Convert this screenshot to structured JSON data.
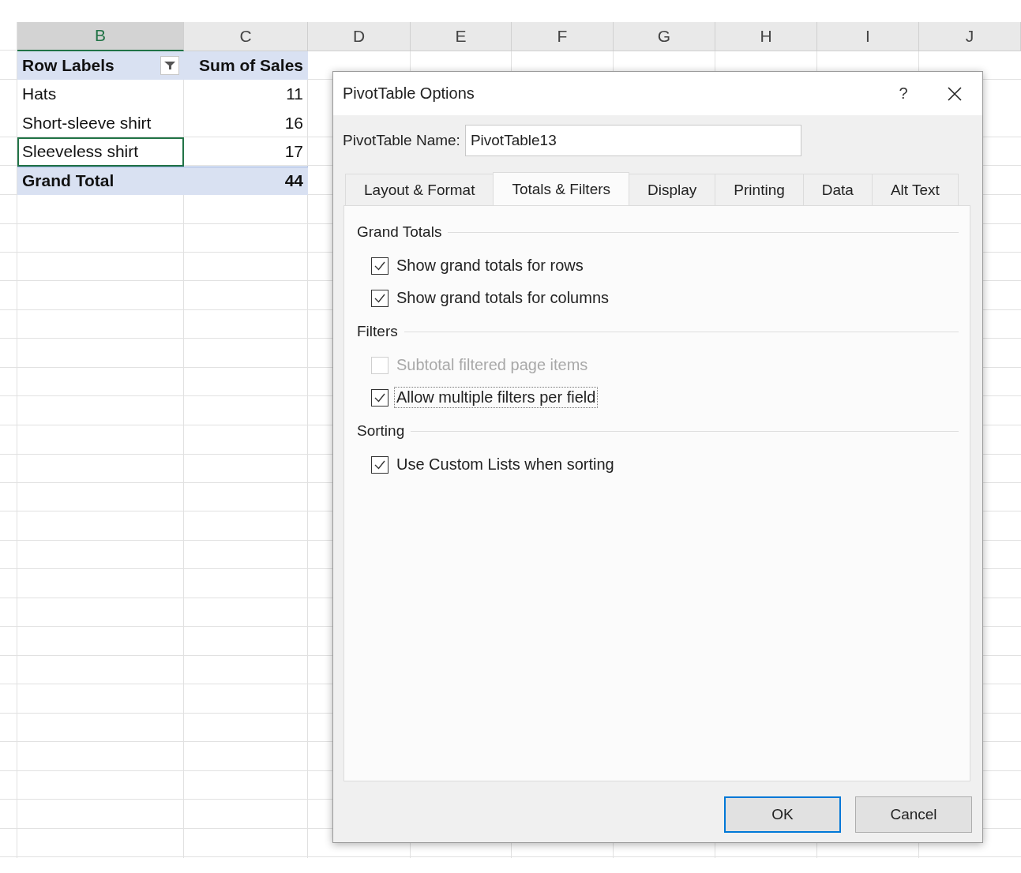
{
  "sheet": {
    "columns": [
      {
        "label": "B",
        "selected": true
      },
      {
        "label": "C",
        "selected": false
      },
      {
        "label": "D",
        "selected": false
      },
      {
        "label": "E",
        "selected": false
      },
      {
        "label": "F",
        "selected": false
      },
      {
        "label": "G",
        "selected": false
      },
      {
        "label": "H",
        "selected": false
      },
      {
        "label": "I",
        "selected": false
      },
      {
        "label": "J",
        "selected": false
      }
    ],
    "pivot": {
      "header": {
        "row_labels": "Row Labels",
        "values": "Sum of Sales"
      },
      "rows": [
        {
          "label": "Hats",
          "value": "11",
          "selected": false
        },
        {
          "label": "Short-sleeve shirt",
          "value": "16",
          "selected": false
        },
        {
          "label": "Sleeveless shirt",
          "value": "17",
          "selected": true
        }
      ],
      "total": {
        "label": "Grand Total",
        "value": "44"
      }
    }
  },
  "dialog": {
    "title": "PivotTable Options",
    "help": "?",
    "name_label": "PivotTable Name:",
    "name_value": "PivotTable13",
    "tabs": [
      {
        "label": "Layout & Format",
        "selected": false
      },
      {
        "label": "Totals & Filters",
        "selected": true
      },
      {
        "label": "Display",
        "selected": false
      },
      {
        "label": "Printing",
        "selected": false
      },
      {
        "label": "Data",
        "selected": false
      },
      {
        "label": "Alt Text",
        "selected": false
      }
    ],
    "sections": [
      {
        "title": "Grand Totals",
        "options": [
          {
            "label": "Show grand totals for rows",
            "checked": true,
            "disabled": false,
            "focused": false
          },
          {
            "label": "Show grand totals for columns",
            "checked": true,
            "disabled": false,
            "focused": false
          }
        ]
      },
      {
        "title": "Filters",
        "options": [
          {
            "label": "Subtotal filtered page items",
            "checked": false,
            "disabled": true,
            "focused": false
          },
          {
            "label": "Allow multiple filters per field",
            "checked": true,
            "disabled": false,
            "focused": true
          }
        ]
      },
      {
        "title": "Sorting",
        "options": [
          {
            "label": "Use Custom Lists when sorting",
            "checked": true,
            "disabled": false,
            "focused": false
          }
        ]
      }
    ],
    "buttons": [
      {
        "label": "OK",
        "default": true
      },
      {
        "label": "Cancel",
        "default": false
      }
    ]
  }
}
